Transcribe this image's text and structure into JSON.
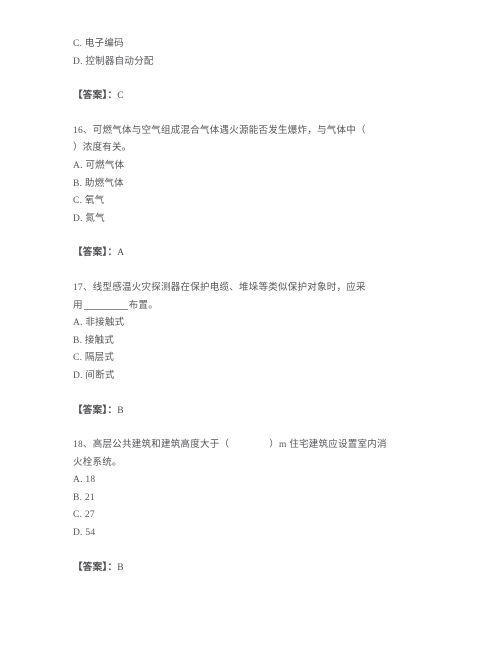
{
  "document": {
    "type": "exam-question-sheet",
    "language": "zh-CN",
    "background_color": "#ffffff",
    "text_color": "#56565a",
    "answer_prefix": "【答案】：",
    "blocks": [
      {
        "kind": "trailing-options",
        "options": [
          "C. 电子编码",
          "D. 控制器自动分配"
        ],
        "answer_label": "【答案】：",
        "answer_value": "C"
      },
      {
        "kind": "question",
        "number": "16",
        "stem_line_1": "16、可燃气体与空气组成混合气体遇火源能否发生爆炸，与气体中（",
        "stem_line_2": "）浓度有关。",
        "options": [
          "A. 可燃气体",
          "B. 助燃气体",
          "C. 氧气",
          "D. 氮气"
        ],
        "answer_label": "【答案】：",
        "answer_value": "A"
      },
      {
        "kind": "question",
        "number": "17",
        "stem_line_1": "17、线型感温火灾探测器在保护电缆、堆垛等类似保护对象时，应采",
        "stem_line_2_before": "用",
        "stem_line_2_after": "布置。",
        "options": [
          "A. 非接触式",
          "B. 接触式",
          "C. 隔层式",
          "D. 间断式"
        ],
        "answer_label": "【答案】：",
        "answer_value": "B"
      },
      {
        "kind": "question",
        "number": "18",
        "stem_line_1_before": "18、高层公共建筑和建筑高度大于（",
        "stem_line_1_after": "）m 住宅建筑应设置室内消",
        "stem_line_2": "火栓系统。",
        "options": [
          "A. 18",
          "B. 21",
          "C. 27",
          "D. 54"
        ],
        "answer_label": "【答案】：",
        "answer_value": "B"
      }
    ]
  }
}
